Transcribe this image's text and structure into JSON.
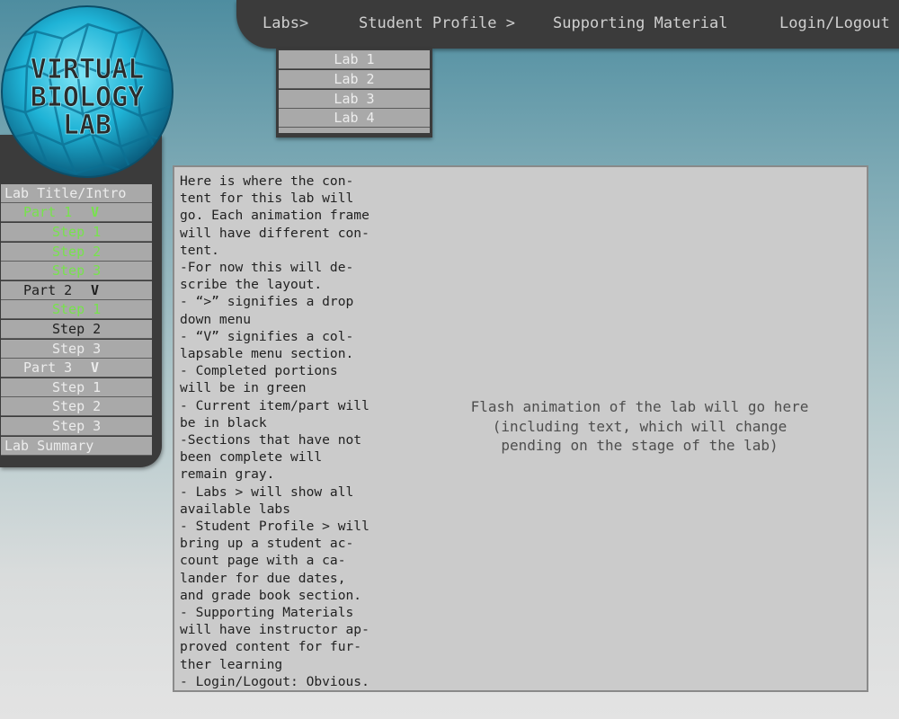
{
  "logo": {
    "line1": "VIRTUAL",
    "line2": "BIOLOGY",
    "line3": "LAB"
  },
  "nav": {
    "labs": "Labs>",
    "student_profile": "Student Profile >",
    "supporting_material": "Supporting Material",
    "login_logout": "Login/Logout"
  },
  "labs_dropdown": {
    "items": [
      "Lab 1",
      "Lab 2",
      "Lab 3",
      "Lab 4"
    ]
  },
  "sidebar": {
    "items": [
      {
        "label": "Lab Title/Intro",
        "chevron": "",
        "state": "gray"
      },
      {
        "label": "Part 1",
        "chevron": "V",
        "state": "green"
      },
      {
        "label": "Step 1",
        "chevron": "",
        "state": "green"
      },
      {
        "label": "Step 2",
        "chevron": "",
        "state": "green"
      },
      {
        "label": "Step 3",
        "chevron": "",
        "state": "green"
      },
      {
        "label": "Part 2",
        "chevron": "V",
        "state": "black"
      },
      {
        "label": "Step 1",
        "chevron": "",
        "state": "green"
      },
      {
        "label": "Step 2",
        "chevron": "",
        "state": "black"
      },
      {
        "label": "Step 3",
        "chevron": "",
        "state": "gray"
      },
      {
        "label": "Part 3",
        "chevron": "V",
        "state": "gray"
      },
      {
        "label": "Step 1",
        "chevron": "",
        "state": "gray"
      },
      {
        "label": "Step 2",
        "chevron": "",
        "state": "gray"
      },
      {
        "label": "Step 3",
        "chevron": "",
        "state": "gray"
      },
      {
        "label": "Lab Summary",
        "chevron": "",
        "state": "gray"
      }
    ]
  },
  "content": {
    "description_lines": [
      "Here is where the con-",
      "tent for this lab will",
      "go. Each animation frame",
      "will have different con-",
      "tent.",
      "-For now this will de-",
      "scribe the layout.",
      "- “>” signifies a drop",
      "down menu",
      "- “V” signifies a col-",
      "lapsable menu section.",
      "- Completed portions",
      "will be in green",
      "- Current item/part will",
      "be in black",
      "-Sections that have not",
      "been complete will",
      "remain gray.",
      "- Labs > will show all",
      "available labs",
      "- Student Profile > will",
      "bring up a student ac-",
      "count page with a ca-",
      "lander for due dates,",
      "and grade book section.",
      "- Supporting Materials",
      "will have instructor ap-",
      "proved content for fur-",
      "ther learning",
      "- Login/Logout: Obvious."
    ],
    "flash_lines": [
      "Flash animation of the lab will go here",
      "(including text, which will change",
      "pending on the stage of the lab)"
    ]
  },
  "colors": {
    "completed": "#77e34c",
    "current": "#1e1e1e",
    "incomplete": "#ececec",
    "logo_cyan": "#22b8d8"
  }
}
